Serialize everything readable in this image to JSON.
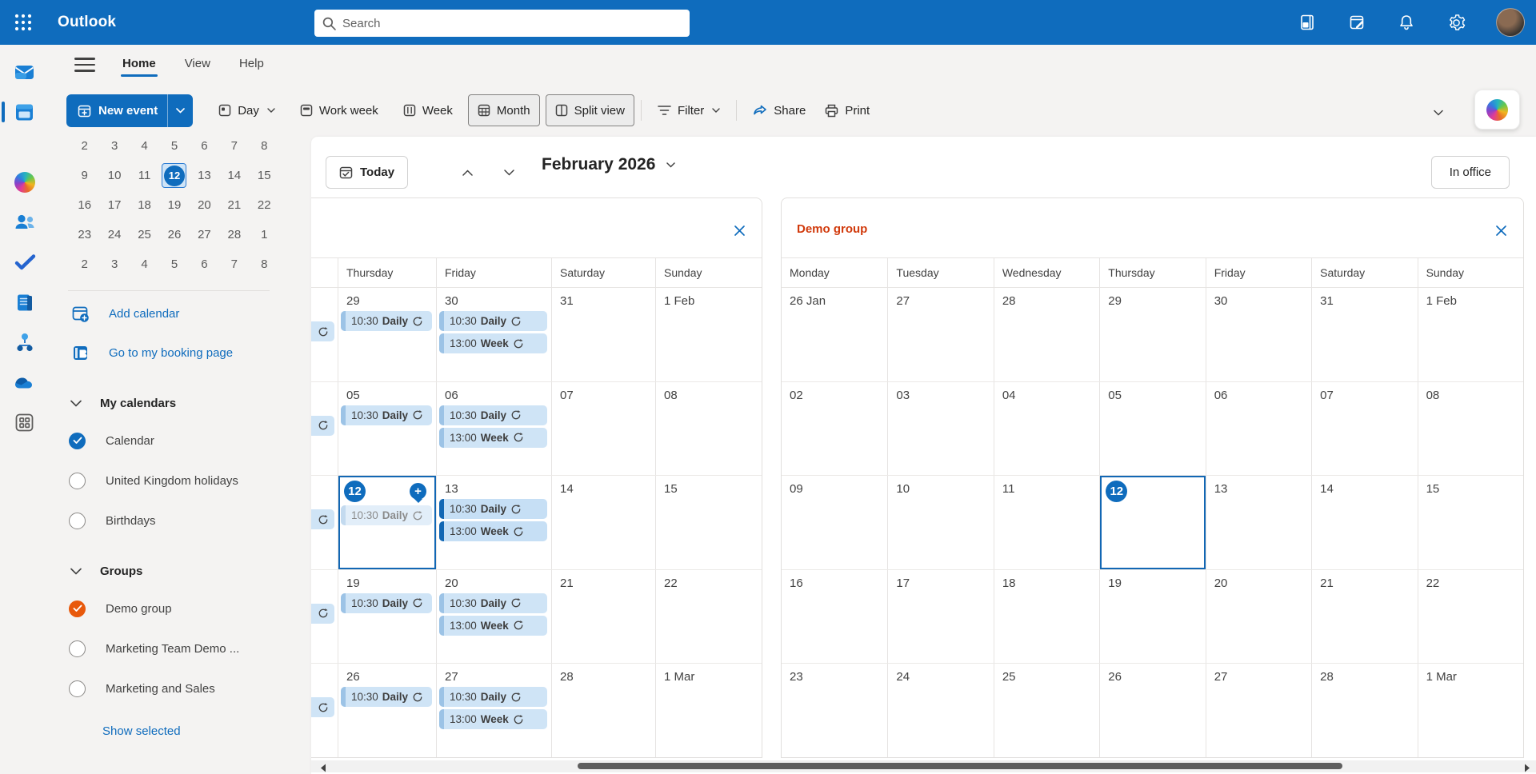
{
  "topbar": {
    "app_name": "Outlook",
    "search_placeholder": "Search",
    "icons": [
      "app-launcher",
      "notes",
      "my-day-tasks",
      "notifications",
      "settings",
      "account-avatar"
    ]
  },
  "rail": {
    "items": [
      "mail",
      "calendar",
      "copilot",
      "people",
      "to-do",
      "notebook",
      "org-chart",
      "onedrive",
      "more-apps"
    ],
    "active": "calendar"
  },
  "menubar": {
    "tabs": [
      "Home",
      "View",
      "Help"
    ],
    "active": "Home"
  },
  "toolbar": {
    "new_event": "New event",
    "views": [
      {
        "label": "Day",
        "dropdown": true,
        "toggled": false
      },
      {
        "label": "Work week",
        "dropdown": false,
        "toggled": false
      },
      {
        "label": "Week",
        "dropdown": false,
        "toggled": false
      },
      {
        "label": "Month",
        "dropdown": false,
        "toggled": true
      },
      {
        "label": "Split view",
        "dropdown": false,
        "toggled": true
      }
    ],
    "filter": "Filter",
    "share": "Share",
    "print": "Print"
  },
  "sidebar": {
    "mini_calendar": {
      "rows": [
        [
          "2",
          "3",
          "4",
          "5",
          "6",
          "7",
          "8"
        ],
        [
          "9",
          "10",
          "11",
          "12",
          "13",
          "14",
          "15"
        ],
        [
          "16",
          "17",
          "18",
          "19",
          "20",
          "21",
          "22"
        ],
        [
          "23",
          "24",
          "25",
          "26",
          "27",
          "28",
          "1"
        ],
        [
          "2",
          "3",
          "4",
          "5",
          "6",
          "7",
          "8"
        ]
      ],
      "selected": {
        "row": 1,
        "col": 3,
        "day": "12"
      }
    },
    "links": [
      {
        "label": "Add calendar",
        "icon": "add-calendar-icon"
      },
      {
        "label": "Go to my booking page",
        "icon": "booking-page-icon"
      }
    ],
    "sections": [
      {
        "title": "My calendars",
        "items": [
          {
            "label": "Calendar",
            "state": "checked",
            "color": "#0f6cbd"
          },
          {
            "label": "United Kingdom holidays",
            "state": "unchecked",
            "color": ""
          },
          {
            "label": "Birthdays",
            "state": "unchecked",
            "color": ""
          }
        ]
      },
      {
        "title": "Groups",
        "items": [
          {
            "label": "Demo group",
            "state": "checked",
            "color": "#e8590c"
          },
          {
            "label": "Marketing Team Demo ...",
            "state": "unchecked",
            "color": ""
          },
          {
            "label": "Marketing and Sales",
            "state": "unchecked",
            "color": ""
          }
        ]
      }
    ],
    "show_selected": "Show selected"
  },
  "calendar_header": {
    "today": "Today",
    "title": "February 2026",
    "presence": "In office"
  },
  "panels": {
    "left": {
      "title": "",
      "days": [
        "",
        "Thursday",
        "Friday",
        "Saturday",
        "Sunday"
      ],
      "weeks": [
        {
          "cells": [
            {
              "strip": true
            },
            {
              "date": "29",
              "events": [
                {
                  "time": "10:30",
                  "title": "Daily",
                  "recurring": true,
                  "variant": ""
                }
              ]
            },
            {
              "date": "30",
              "events": [
                {
                  "time": "10:30",
                  "title": "Daily",
                  "recurring": true,
                  "variant": ""
                },
                {
                  "time": "13:00",
                  "title": "Week",
                  "recurring": true,
                  "variant": ""
                }
              ]
            },
            {
              "date": "31",
              "events": []
            },
            {
              "date": "1 Feb",
              "events": []
            }
          ]
        },
        {
          "cells": [
            {
              "strip": true
            },
            {
              "date": "05",
              "events": [
                {
                  "time": "10:30",
                  "title": "Daily",
                  "recurring": true,
                  "variant": ""
                }
              ]
            },
            {
              "date": "06",
              "events": [
                {
                  "time": "10:30",
                  "title": "Daily",
                  "recurring": true,
                  "variant": ""
                },
                {
                  "time": "13:00",
                  "title": "Week",
                  "recurring": true,
                  "variant": ""
                }
              ]
            },
            {
              "date": "07",
              "events": []
            },
            {
              "date": "08",
              "events": []
            }
          ]
        },
        {
          "cells": [
            {
              "strip": true
            },
            {
              "date": "12",
              "selected": true,
              "today_circle": true,
              "quick_add": true,
              "events": [
                {
                  "time": "10:30",
                  "title": "Daily",
                  "recurring": true,
                  "variant": "faded"
                }
              ]
            },
            {
              "date": "13",
              "events": [
                {
                  "time": "10:30",
                  "title": "Daily",
                  "recurring": true,
                  "variant": "strong"
                },
                {
                  "time": "13:00",
                  "title": "Week",
                  "recurring": true,
                  "variant": "strong"
                }
              ]
            },
            {
              "date": "14",
              "events": []
            },
            {
              "date": "15",
              "events": []
            }
          ]
        },
        {
          "cells": [
            {
              "strip": true
            },
            {
              "date": "19",
              "events": [
                {
                  "time": "10:30",
                  "title": "Daily",
                  "recurring": true,
                  "variant": ""
                }
              ]
            },
            {
              "date": "20",
              "events": [
                {
                  "time": "10:30",
                  "title": "Daily",
                  "recurring": true,
                  "variant": ""
                },
                {
                  "time": "13:00",
                  "title": "Week",
                  "recurring": true,
                  "variant": ""
                }
              ]
            },
            {
              "date": "21",
              "events": []
            },
            {
              "date": "22",
              "events": []
            }
          ]
        },
        {
          "cells": [
            {
              "strip": true
            },
            {
              "date": "26",
              "events": [
                {
                  "time": "10:30",
                  "title": "Daily",
                  "recurring": true,
                  "variant": ""
                }
              ]
            },
            {
              "date": "27",
              "events": [
                {
                  "time": "10:30",
                  "title": "Daily",
                  "recurring": true,
                  "variant": ""
                },
                {
                  "time": "13:00",
                  "title": "Week",
                  "recurring": true,
                  "variant": ""
                }
              ]
            },
            {
              "date": "28",
              "events": []
            },
            {
              "date": "1 Mar",
              "events": []
            }
          ]
        }
      ]
    },
    "right": {
      "title": "Demo group",
      "title_color": "#d13a0c",
      "days": [
        "Monday",
        "Tuesday",
        "Wednesday",
        "Thursday",
        "Friday",
        "Saturday",
        "Sunday"
      ],
      "weeks": [
        [
          "26 Jan",
          "27",
          "28",
          "29",
          "30",
          "31",
          "1 Feb"
        ],
        [
          "02",
          "03",
          "04",
          "05",
          "06",
          "07",
          "08"
        ],
        [
          "09",
          "10",
          "11",
          "12",
          "13",
          "14",
          "15"
        ],
        [
          "16",
          "17",
          "18",
          "19",
          "20",
          "21",
          "22"
        ],
        [
          "23",
          "24",
          "25",
          "26",
          "27",
          "28",
          "1 Mar"
        ]
      ],
      "selected": {
        "week": 2,
        "day": 3,
        "date": "12"
      }
    }
  },
  "colors": {
    "accent": "#0f6cbd",
    "group_orange": "#e8590c",
    "panel_title_orange": "#d13a0c"
  }
}
